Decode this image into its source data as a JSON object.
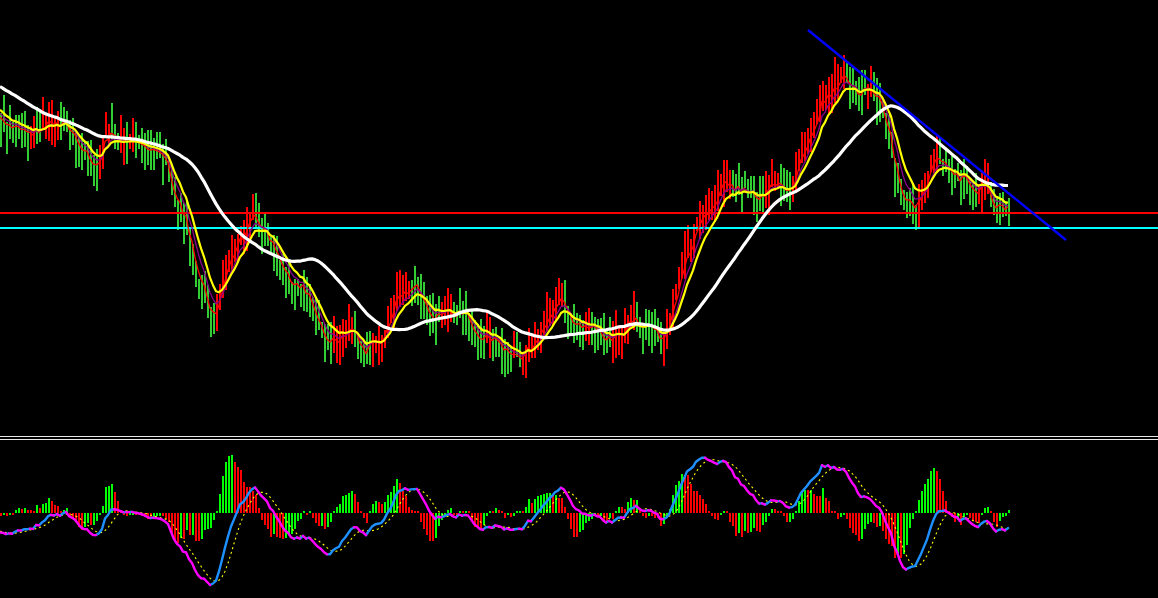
{
  "price_panel": {
    "bar_series": [
      {
        "kind": "rising",
        "color": "#ff0000"
      },
      {
        "kind": "falling",
        "color": "#32cd32"
      }
    ],
    "moving_averages": [
      {
        "color": "#ffffff"
      },
      {
        "color": "#ffff00"
      },
      {
        "color": "#8b008b"
      },
      {
        "color": "#ff0000"
      }
    ]
  },
  "oscillator_panel": {
    "histogram_series": [
      {
        "kind": "rising",
        "color": "#00ff00"
      },
      {
        "kind": "falling",
        "color": "#ff0000"
      }
    ],
    "line_segments": [
      {
        "kind": "rising",
        "color": "#1e90ff"
      },
      {
        "kind": "falling",
        "color": "#ff00ff"
      }
    ]
  }
}
